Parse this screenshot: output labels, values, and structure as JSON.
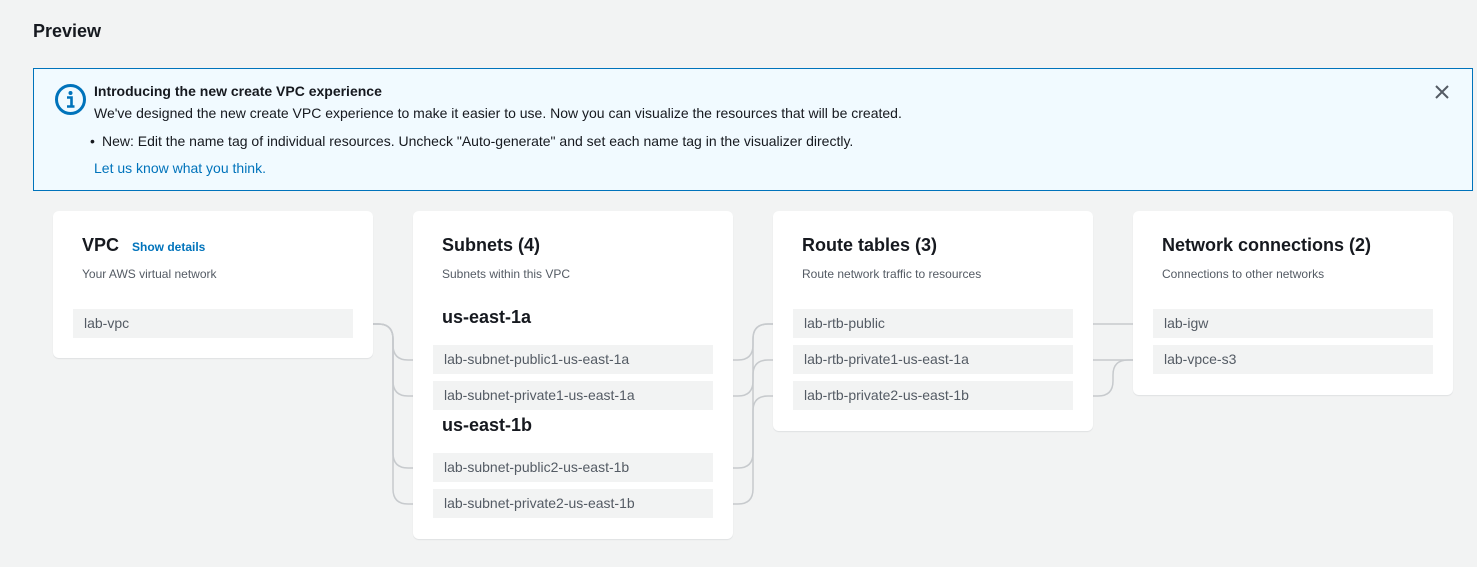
{
  "page": {
    "title": "Preview"
  },
  "banner": {
    "title": "Introducing the new create VPC experience",
    "text": "We've designed the new create VPC experience to make it easier to use. Now you can visualize the resources that will be created.",
    "bullet": "New: Edit the name tag of individual resources. Uncheck \"Auto-generate\" and set each name tag in the visualizer directly.",
    "link": "Let us know what you think.",
    "icon": "info-circle-icon",
    "close_icon": "close-icon"
  },
  "vpc": {
    "title": "VPC",
    "show_details": "Show details",
    "subtitle": "Your AWS virtual network",
    "items": [
      "lab-vpc"
    ]
  },
  "subnets": {
    "title": "Subnets (4)",
    "subtitle": "Subnets within this VPC",
    "az1": {
      "name": "us-east-1a",
      "items": [
        "lab-subnet-public1-us-east-1a",
        "lab-subnet-private1-us-east-1a"
      ]
    },
    "az2": {
      "name": "us-east-1b",
      "items": [
        "lab-subnet-public2-us-east-1b",
        "lab-subnet-private2-us-east-1b"
      ]
    }
  },
  "route_tables": {
    "title": "Route tables (3)",
    "subtitle": "Route network traffic to resources",
    "items": [
      "lab-rtb-public",
      "lab-rtb-private1-us-east-1a",
      "lab-rtb-private2-us-east-1b"
    ]
  },
  "network_connections": {
    "title": "Network connections (2)",
    "subtitle": "Connections to other networks",
    "items": [
      "lab-igw",
      "lab-vpce-s3"
    ]
  },
  "colors": {
    "accent": "#0073bb",
    "banner_bg": "#f1faff",
    "connector": "#c7cacd"
  }
}
